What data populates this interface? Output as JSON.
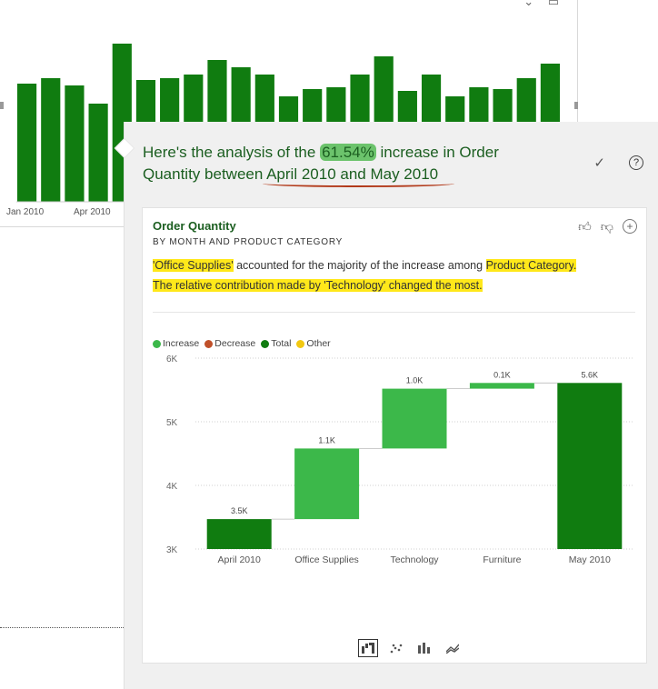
{
  "background_visual": {
    "x_labels": [
      "Jan 2010",
      "Apr 2010"
    ],
    "bar_color": "#107c10",
    "bars": [
      0.65,
      0.68,
      0.64,
      0.54,
      0.87,
      0.67,
      0.68,
      0.7,
      0.78,
      0.74,
      0.7,
      0.58,
      0.62,
      0.63,
      0.7,
      0.8,
      0.61,
      0.7,
      0.58,
      0.63,
      0.62,
      0.68,
      0.76
    ]
  },
  "analysis": {
    "heading_pre": "Here's the analysis of the ",
    "heading_percent": "61.54%",
    "heading_mid": " increase in Order Quantity between ",
    "heading_range": "April 2010 and May 2010",
    "accent_color": "#107c10",
    "card": {
      "title": "Order Quantity",
      "subtitle": "BY MONTH AND PRODUCT CATEGORY",
      "insight": {
        "part1_hl": "'Office Supplies'",
        "part2": " accounted for the majority of the increase among ",
        "part3_hl": "Product Category",
        "part4": ".",
        "line2_pre": "The relative ",
        "line2_hl": "contribution made by 'Technology' changed the most."
      },
      "legend": [
        {
          "label": "Increase",
          "color": "#3cb84a"
        },
        {
          "label": "Decrease",
          "color": "#c0502a"
        },
        {
          "label": "Total",
          "color": "#107c10"
        },
        {
          "label": "Other",
          "color": "#f2c811"
        }
      ],
      "icons": [
        "thumbs-up-icon",
        "thumbs-down-icon",
        "plus-circle-icon"
      ],
      "viz_buttons": [
        "waterfall-icon",
        "scatter-icon",
        "column-icon",
        "ribbon-icon"
      ]
    }
  },
  "chart_data": {
    "type": "bar",
    "subtype": "waterfall",
    "categories": [
      "April 2010",
      "Office Supplies",
      "Technology",
      "Furniture",
      "May 2010"
    ],
    "values": [
      3.5,
      1.1,
      1.0,
      0.1,
      5.6
    ],
    "value_labels": [
      "3.5K",
      "1.1K",
      "1.0K",
      "0.1K",
      "5.6K"
    ],
    "starts": [
      3.0,
      3.47,
      4.58,
      5.52,
      3.0
    ],
    "ends": [
      3.47,
      4.58,
      5.52,
      5.61,
      5.61
    ],
    "kinds": [
      "total",
      "increase",
      "increase",
      "increase",
      "total"
    ],
    "y_ticks": [
      "3K",
      "4K",
      "5K",
      "6K"
    ],
    "y_tick_values": [
      3,
      4,
      5,
      6
    ],
    "ylim": [
      3,
      6
    ],
    "unit": "K",
    "grid": true
  }
}
